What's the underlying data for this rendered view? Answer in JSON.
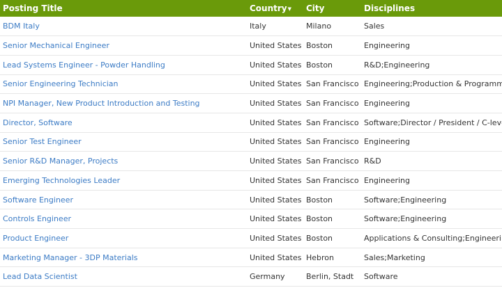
{
  "table": {
    "headers": {
      "title": "Posting Title",
      "country": "Country",
      "city": "City",
      "disciplines": "Disciplines"
    },
    "sort_icon": "sort-down-icon",
    "rows": [
      {
        "title": "BDM Italy",
        "country": "Italy",
        "city": "Milano",
        "disciplines": "Sales"
      },
      {
        "title": "Senior Mechanical Engineer",
        "country": "United States",
        "city": "Boston",
        "disciplines": "Engineering"
      },
      {
        "title": "Lead Systems Engineer - Powder Handling",
        "country": "United States",
        "city": "Boston",
        "disciplines": "R&D;Engineering"
      },
      {
        "title": "Senior Engineering Technician",
        "country": "United States",
        "city": "San Francisco",
        "disciplines": "Engineering;Production & Programmers"
      },
      {
        "title": "NPI Manager, New Product Introduction and Testing",
        "country": "United States",
        "city": "San Francisco",
        "disciplines": "Engineering"
      },
      {
        "title": "Director, Software",
        "country": "United States",
        "city": "San Francisco",
        "disciplines": "Software;Director / President / C-level"
      },
      {
        "title": "Senior Test Engineer",
        "country": "United States",
        "city": "San Francisco",
        "disciplines": "Engineering"
      },
      {
        "title": "Senior R&D Manager, Projects",
        "country": "United States",
        "city": "San Francisco",
        "disciplines": "R&D"
      },
      {
        "title": "Emerging Technologies Leader",
        "country": "United States",
        "city": "San Francisco",
        "disciplines": "Engineering"
      },
      {
        "title": "Software Engineer",
        "country": "United States",
        "city": "Boston",
        "disciplines": "Software;Engineering"
      },
      {
        "title": "Controls Engineer",
        "country": "United States",
        "city": "Boston",
        "disciplines": "Software;Engineering"
      },
      {
        "title": "Product Engineer",
        "country": "United States",
        "city": "Boston",
        "disciplines": "Applications & Consulting;Engineering"
      },
      {
        "title": "Marketing Manager - 3DP Materials",
        "country": "United States",
        "city": "Hebron",
        "disciplines": "Sales;Marketing"
      },
      {
        "title": "Lead Data Scientist",
        "country": "Germany",
        "city": "Berlin, Stadt",
        "disciplines": "Software"
      }
    ]
  },
  "colors": {
    "header_bg": "#6a9a0a",
    "link": "#3b7bc5",
    "text": "#333333"
  }
}
